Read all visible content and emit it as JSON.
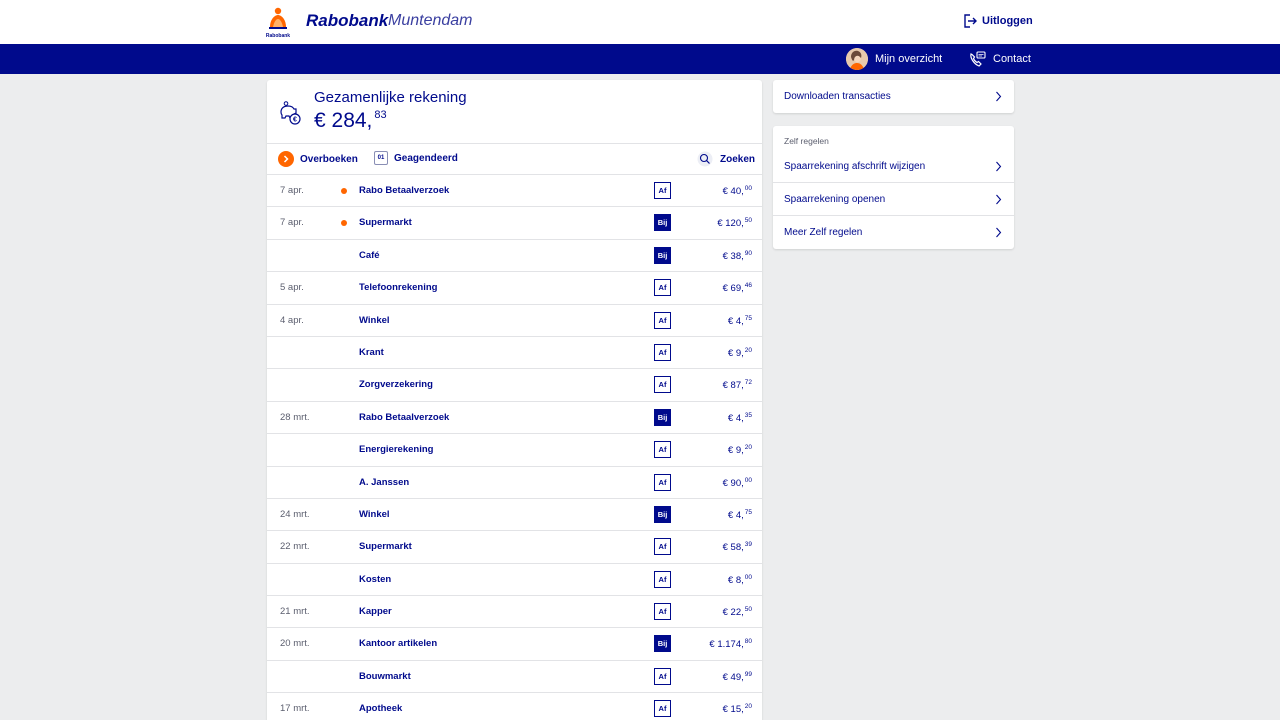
{
  "header": {
    "brand": "Rabobank",
    "logo_text": "Rabobank",
    "branch": "Muntendam",
    "logout_label": "Uitloggen"
  },
  "nav": {
    "overview_label": "Mijn overzicht",
    "contact_label": "Contact"
  },
  "account": {
    "name": "Gezamenlijke rekening",
    "balance_main": "€ 284,",
    "balance_cents": "83"
  },
  "actions": {
    "transfer_label": "Overboeken",
    "scheduled_label": "Geagendeerd",
    "calendar_text": "01",
    "search_label": "Zoeken"
  },
  "transactions": [
    {
      "date": "7 apr.",
      "dot": true,
      "name": "Rabo Betaalverzoek",
      "type": "Af",
      "amount": "€ 40,",
      "cents": "00"
    },
    {
      "date": "7 apr.",
      "dot": true,
      "name": "Supermarkt",
      "type": "Bij",
      "amount": "€ 120,",
      "cents": "50"
    },
    {
      "date": "",
      "dot": false,
      "name": "Café",
      "type": "Bij",
      "amount": "€ 38,",
      "cents": "90"
    },
    {
      "date": "5 apr.",
      "dot": false,
      "name": "Telefoonrekening",
      "type": "Af",
      "amount": "€ 69,",
      "cents": "46"
    },
    {
      "date": "4 apr.",
      "dot": false,
      "name": "Winkel",
      "type": "Af",
      "amount": "€ 4,",
      "cents": "75"
    },
    {
      "date": "",
      "dot": false,
      "name": "Krant",
      "type": "Af",
      "amount": "€ 9,",
      "cents": "20"
    },
    {
      "date": "",
      "dot": false,
      "name": "Zorgverzekering",
      "type": "Af",
      "amount": "€ 87,",
      "cents": "72"
    },
    {
      "date": "28 mrt.",
      "dot": false,
      "name": "Rabo Betaalverzoek",
      "type": "Bij",
      "amount": "€ 4,",
      "cents": "35"
    },
    {
      "date": "",
      "dot": false,
      "name": "Energierekening",
      "type": "Af",
      "amount": "€ 9,",
      "cents": "20"
    },
    {
      "date": "",
      "dot": false,
      "name": "A. Janssen",
      "type": "Af",
      "amount": "€ 90,",
      "cents": "00"
    },
    {
      "date": "24 mrt.",
      "dot": false,
      "name": "Winkel",
      "type": "Bij",
      "amount": "€ 4,",
      "cents": "75"
    },
    {
      "date": "22 mrt.",
      "dot": false,
      "name": "Supermarkt",
      "type": "Af",
      "amount": "€ 58,",
      "cents": "39"
    },
    {
      "date": "",
      "dot": false,
      "name": "Kosten",
      "type": "Af",
      "amount": "€ 8,",
      "cents": "00"
    },
    {
      "date": "21 mrt.",
      "dot": false,
      "name": "Kapper",
      "type": "Af",
      "amount": "€ 22,",
      "cents": "50"
    },
    {
      "date": "20 mrt.",
      "dot": false,
      "name": "Kantoor artikelen",
      "type": "Bij",
      "amount": "€ 1.174,",
      "cents": "80"
    },
    {
      "date": "",
      "dot": false,
      "name": "Bouwmarkt",
      "type": "Af",
      "amount": "€ 49,",
      "cents": "99"
    },
    {
      "date": "17 mrt.",
      "dot": false,
      "name": "Apotheek",
      "type": "Af",
      "amount": "€ 15,",
      "cents": "20"
    }
  ],
  "sidebar": {
    "download_label": "Downloaden transacties",
    "self_service_heading": "Zelf regelen",
    "links": [
      {
        "label": "Spaarrekening afschrift wijzigen"
      },
      {
        "label": "Spaarrekening openen"
      },
      {
        "label": "Meer Zelf regelen"
      }
    ]
  },
  "colors": {
    "brand_blue": "#000a8c",
    "accent_orange": "#ff6600",
    "background": "#ecedee"
  }
}
